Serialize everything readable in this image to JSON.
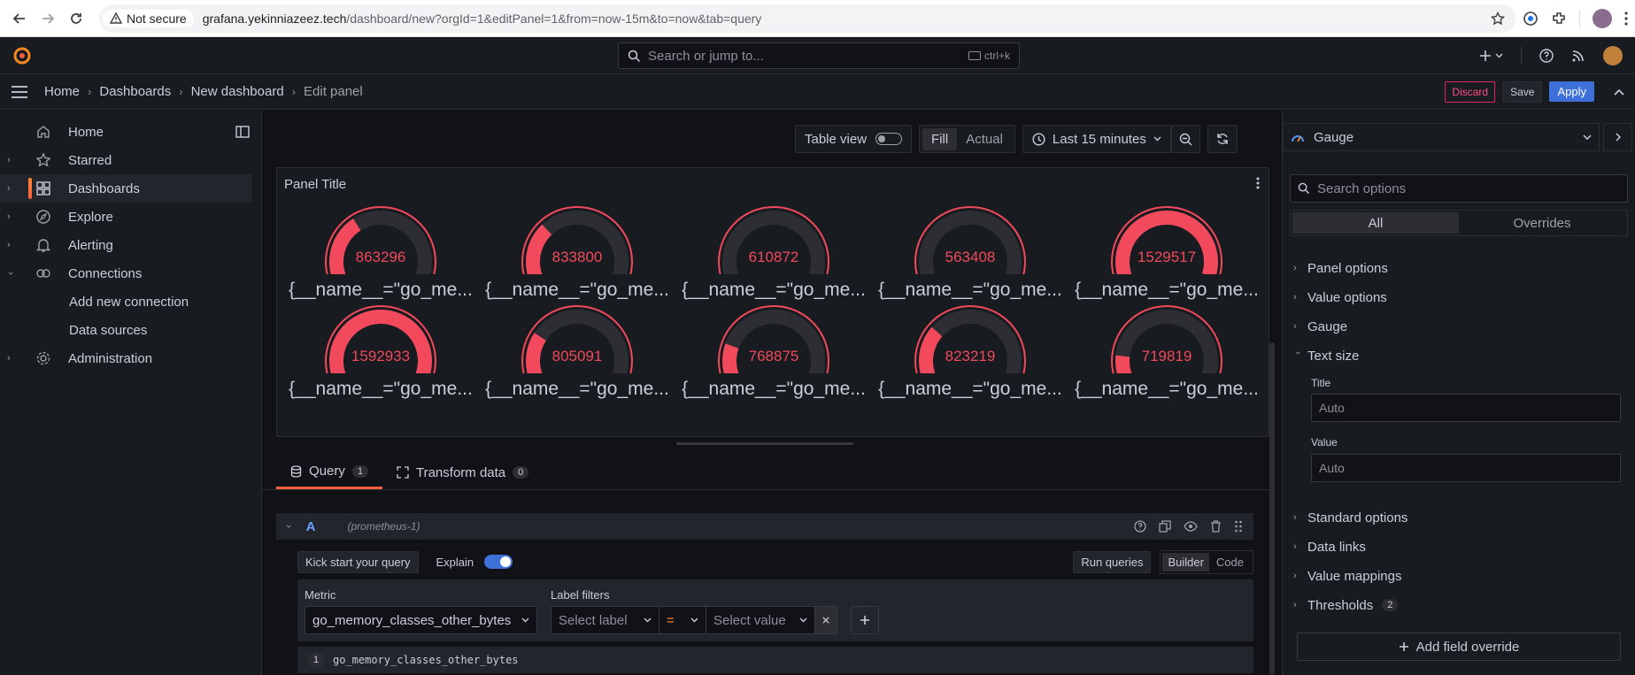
{
  "browser": {
    "security_label": "Not secure",
    "url_host": "grafana.yekinniazeez.tech",
    "url_path": "/dashboard/new?orgId=1&editPanel=1&from=now-15m&to=now&tab=query"
  },
  "topbar": {
    "search_placeholder": "Search or jump to...",
    "search_shortcut": "ctrl+k"
  },
  "breadcrumb": {
    "items": [
      "Home",
      "Dashboards",
      "New dashboard",
      "Edit panel"
    ]
  },
  "actions": {
    "discard": "Discard",
    "save": "Save",
    "apply": "Apply"
  },
  "sidebar": {
    "items": [
      {
        "label": "Home",
        "icon": "home-icon"
      },
      {
        "label": "Starred",
        "icon": "star-icon"
      },
      {
        "label": "Dashboards",
        "icon": "apps-icon"
      },
      {
        "label": "Explore",
        "icon": "compass-icon"
      },
      {
        "label": "Alerting",
        "icon": "bell-icon"
      },
      {
        "label": "Connections",
        "icon": "connections-icon"
      },
      {
        "label": "Add new connection"
      },
      {
        "label": "Data sources"
      },
      {
        "label": "Administration",
        "icon": "cog-icon"
      }
    ]
  },
  "toolbar": {
    "table_view": "Table view",
    "fill": "Fill",
    "actual": "Actual",
    "time_range": "Last 15 minutes"
  },
  "panel": {
    "title": "Panel Title",
    "gauges": [
      {
        "value": "863296",
        "fraction": 0.38,
        "label": "{__name__=\"go_me..."
      },
      {
        "value": "833800",
        "fraction": 0.34,
        "label": "{__name__=\"go_me..."
      },
      {
        "value": "610872",
        "fraction": 0.08,
        "label": "{__name__=\"go_me..."
      },
      {
        "value": "563408",
        "fraction": 0.0,
        "label": "{__name__=\"go_me..."
      },
      {
        "value": "1529517",
        "fraction": 0.9,
        "label": "{__name__=\"go_me..."
      },
      {
        "value": "1592933",
        "fraction": 0.97,
        "label": "{__name__=\"go_me..."
      },
      {
        "value": "805091",
        "fraction": 0.29,
        "label": "{__name__=\"go_me..."
      },
      {
        "value": "768875",
        "fraction": 0.24,
        "label": "{__name__=\"go_me..."
      },
      {
        "value": "823219",
        "fraction": 0.32,
        "label": "{__name__=\"go_me..."
      },
      {
        "value": "719819",
        "fraction": 0.19,
        "label": "{__name__=\"go_me..."
      }
    ],
    "colors": {
      "gauge_fill": "#f2495c",
      "gauge_track": "#2c2e33"
    }
  },
  "tabs": {
    "query": "Query",
    "query_count": "1",
    "transform": "Transform data",
    "transform_count": "0"
  },
  "query": {
    "ref_id": "A",
    "datasource": "(prometheus-1)",
    "kick_start": "Kick start your query",
    "explain": "Explain",
    "run_queries": "Run queries",
    "builder": "Builder",
    "code": "Code",
    "metric_label": "Metric",
    "metric_value": "go_memory_classes_other_bytes",
    "label_filters": "Label filters",
    "select_label": "Select label",
    "operator": "=",
    "select_value": "Select value",
    "line_number": "1",
    "query_text": "go_memory_classes_other_bytes"
  },
  "rightpane": {
    "visualization": "Gauge",
    "search_placeholder": "Search options",
    "all_tab": "All",
    "overrides_tab": "Overrides",
    "sections": [
      "Panel options",
      "Value options",
      "Gauge",
      "Text size"
    ],
    "text_size": {
      "title_label": "Title",
      "title_placeholder": "Auto",
      "value_label": "Value",
      "value_placeholder": "Auto"
    },
    "sections_after": [
      "Standard options",
      "Data links",
      "Value mappings",
      "Thresholds"
    ],
    "thresholds_count": "2",
    "add_override": "Add field override"
  }
}
